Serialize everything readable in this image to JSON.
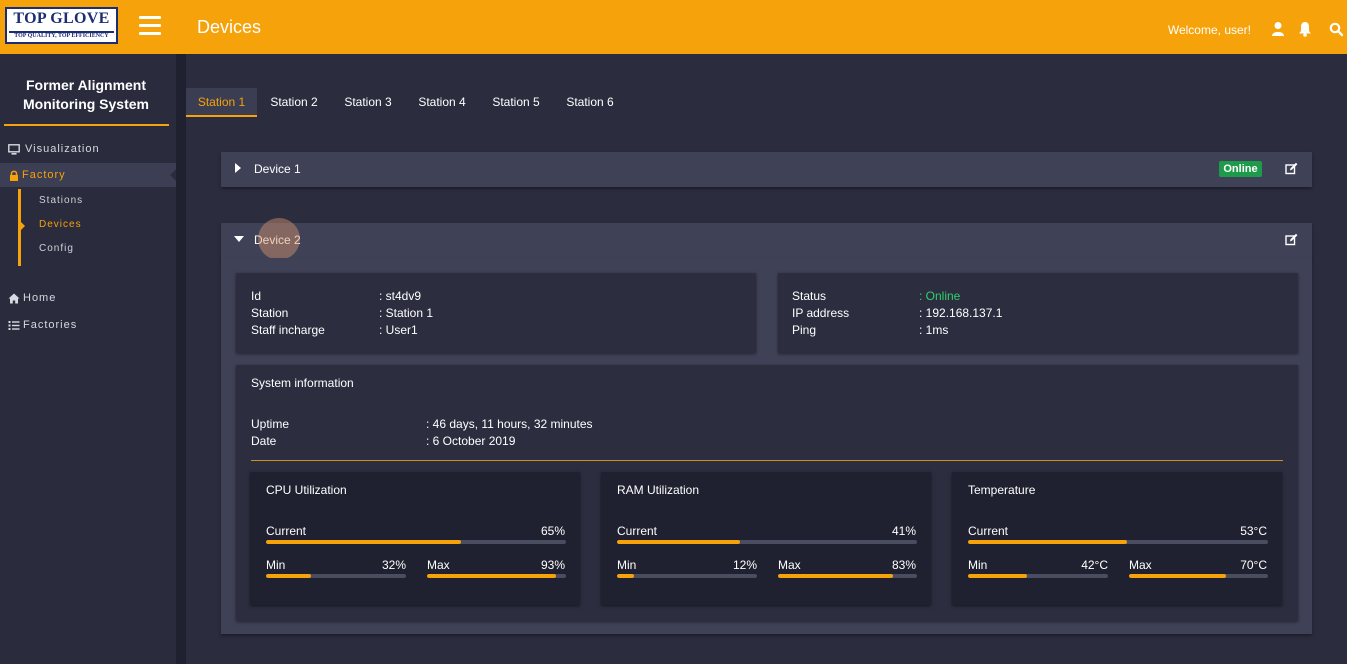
{
  "brand": {
    "logo_main": "TOP GLOVE",
    "logo_sub": "TOP QUALITY, TOP EFFICIENCY"
  },
  "header": {
    "title": "Devices",
    "welcome": "Welcome, user!",
    "icons": [
      "user-icon",
      "bell-icon",
      "search-icon"
    ]
  },
  "sidebar": {
    "system_title_line1": "Former Alignment",
    "system_title_line2": "Monitoring System",
    "items": [
      {
        "label": "Visualization",
        "icon": "monitor-icon"
      },
      {
        "label": "Factory",
        "icon": "lock-icon"
      },
      {
        "label": "Home",
        "icon": "home-icon"
      },
      {
        "label": "Factories",
        "icon": "list-icon"
      }
    ],
    "subitems": [
      "Stations",
      "Devices",
      "Config"
    ]
  },
  "tabs": [
    "Station 1",
    "Station 2",
    "Station 3",
    "Station 4",
    "Station 5",
    "Station 6"
  ],
  "device1": {
    "name": "Device 1",
    "status": "Online"
  },
  "device2": {
    "name": "Device 2",
    "id_label": "Id",
    "id_value": ": st4dv9",
    "station_label": "Station",
    "station_value": ": Station 1",
    "staff_label": "Staff incharge",
    "staff_value": ": User1",
    "status_label": "Status",
    "status_value": ": Online",
    "ip_label": "IP address",
    "ip_value": ": 192.168.137.1",
    "ping_label": "Ping",
    "ping_value": ": 1ms"
  },
  "system": {
    "title": "System information",
    "uptime_label": "Uptime",
    "uptime_value": ": 46 days, 11 hours, 32 minutes",
    "date_label": "Date",
    "date_value": ": 6 October 2019"
  },
  "metrics": [
    {
      "title": "CPU Utilization",
      "current_label": "Current",
      "current": "65%",
      "current_frac": 0.65,
      "min_label": "Min",
      "min": "32%",
      "min_frac": 0.32,
      "max_label": "Max",
      "max": "93%",
      "max_frac": 0.93
    },
    {
      "title": "RAM Utilization",
      "current_label": "Current",
      "current": "41%",
      "current_frac": 0.41,
      "min_label": "Min",
      "min": "12%",
      "min_frac": 0.12,
      "max_label": "Max",
      "max": "83%",
      "max_frac": 0.83
    },
    {
      "title": "Temperature",
      "current_label": "Current",
      "current": "53°C",
      "current_frac": 0.53,
      "min_label": "Min",
      "min": "42°C",
      "min_frac": 0.42,
      "max_label": "Max",
      "max": "70°C",
      "max_frac": 0.7
    }
  ],
  "colors": {
    "accent": "#f6a20a",
    "online": "#1e9b4a",
    "online_text": "#2fd26a"
  }
}
